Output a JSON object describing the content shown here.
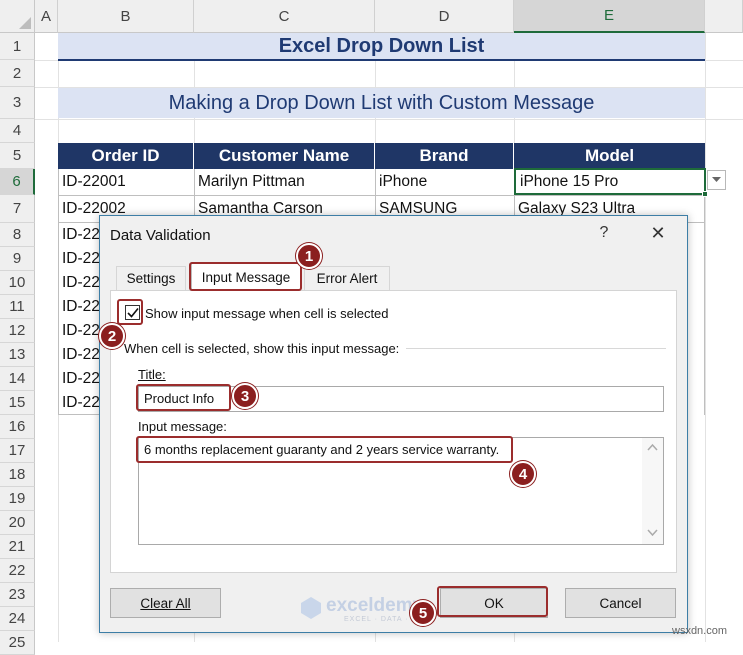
{
  "columns": [
    "A",
    "B",
    "C",
    "D",
    "E"
  ],
  "rows": [
    "1",
    "2",
    "3",
    "4",
    "5",
    "6",
    "7",
    "8",
    "9",
    "10",
    "11",
    "12",
    "13",
    "14",
    "15",
    "16",
    "17",
    "18",
    "19",
    "20",
    "21",
    "22",
    "23",
    "24",
    "25"
  ],
  "title1": "Excel Drop Down List",
  "title2": "Making a Drop Down List with Custom Message",
  "table": {
    "headers": [
      "Order ID",
      "Customer Name",
      "Brand",
      "Model"
    ],
    "row6": [
      "ID-22001",
      "Marilyn Pittman",
      "iPhone",
      "iPhone 15 Pro"
    ],
    "row7": [
      "ID-22002",
      "Samantha Carson",
      "SAMSUNG",
      "Galaxy S23 Ultra"
    ],
    "partial_ids": [
      "ID-22",
      "ID-22",
      "ID-22",
      "ID-22",
      "ID-22",
      "ID-22",
      "ID-22",
      "ID-22"
    ]
  },
  "dialog": {
    "title": "Data Validation",
    "help": "?",
    "close": "✕",
    "tabs": [
      "Settings",
      "Input Message",
      "Error Alert"
    ],
    "checkbox_label": "Show input message when cell is selected",
    "checkbox_checked": true,
    "section_label": "When cell is selected, show this input message:",
    "title_label": "Title:",
    "title_value": "Product Info",
    "message_label": "Input message:",
    "message_value": "6 months replacement guaranty and 2 years service warranty.",
    "buttons": {
      "clear": "Clear All",
      "ok": "OK",
      "cancel": "Cancel"
    }
  },
  "badges": [
    "1",
    "2",
    "3",
    "4",
    "5"
  ],
  "watermark": "exceldemy",
  "watermark_sub": "EXCEL · DATA · BI",
  "site": "wsxdn.com",
  "colors": {
    "accent": "#1e6b3a",
    "header_fill": "#1f3666",
    "banner_fill": "#dce3f3",
    "highlight": "#9b2d2d"
  }
}
